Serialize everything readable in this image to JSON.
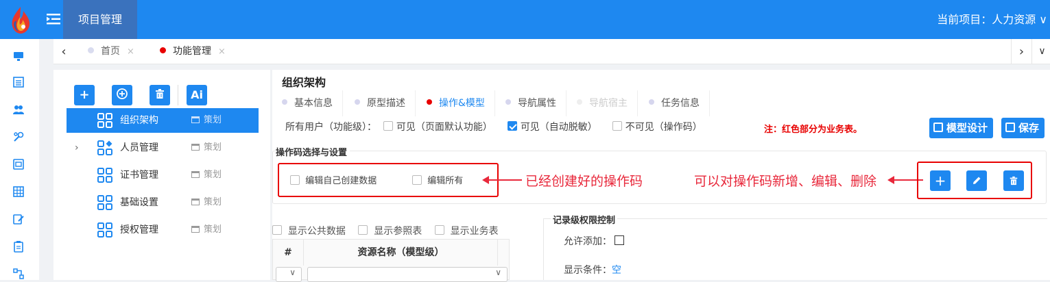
{
  "topbar": {
    "app_title": "项目管理",
    "current_project": "当前项目：人力资源 ∨"
  },
  "tabs": [
    {
      "label": "首页",
      "close": "×",
      "dot_color": "#d9dcef"
    },
    {
      "label": "功能管理",
      "close": "×",
      "dot_color": "#e80000"
    }
  ],
  "tree": {
    "toolbar": {
      "ai_label": "Ai"
    },
    "items": [
      {
        "name": "组织架构",
        "tag": "策划",
        "selected": true
      },
      {
        "name": "人员管理",
        "tag": "策划",
        "expandable": true
      },
      {
        "name": "证书管理",
        "tag": "策划"
      },
      {
        "name": "基础设置",
        "tag": "策划"
      },
      {
        "name": "授权管理",
        "tag": "策划"
      }
    ]
  },
  "main": {
    "title": "组织架构",
    "subtabs": [
      {
        "label": "基本信息",
        "state": "normal"
      },
      {
        "label": "原型描述",
        "state": "normal"
      },
      {
        "label": "操作&模型",
        "state": "active"
      },
      {
        "label": "导航属性",
        "state": "normal"
      },
      {
        "label": "导航宿主",
        "state": "disabled"
      },
      {
        "label": "任务信息",
        "state": "normal"
      }
    ],
    "permission": {
      "label": "所有用户（功能级）：",
      "options": [
        {
          "label": "可见（页面默认功能）",
          "checked": false
        },
        {
          "label": "可见（自动脱敏）",
          "checked": true
        },
        {
          "label": "不可见（操作码）",
          "checked": false
        }
      ]
    },
    "note": "注：红色部分为业务表。",
    "model_design_label": "模型设计",
    "save_label": "保存",
    "opcode_section": {
      "title": "操作码选择与设置",
      "items": [
        "编辑自己创建数据",
        "编辑所有"
      ],
      "annotation_left": "已经创建好的操作码",
      "annotation_right": "可以对操作码新增、编辑、删除"
    },
    "show_options": [
      "显示公共数据",
      "显示参照表",
      "显示业务表"
    ],
    "grid": {
      "col_hash": "#",
      "col_name": "资源名称（模型级）"
    },
    "record_control": {
      "title": "记录级权限控制",
      "allow_add_label": "允许添加：",
      "condition_label": "显示条件：",
      "condition_value": "空"
    }
  }
}
